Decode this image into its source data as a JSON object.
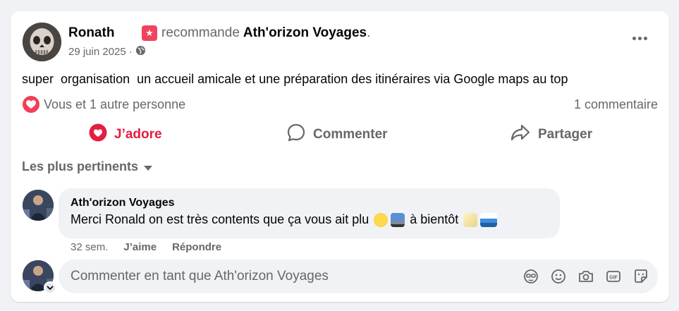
{
  "post": {
    "author": "Ronath",
    "badge_text": "recommande",
    "badge_page": "Ath'orizon Voyages",
    "badge_dot": ".",
    "date": "29 juin 2025",
    "date_separator": "·",
    "privacy_icon": "globe-icon",
    "text": "super  organisation  un accueil amicale et une préparation des itinéraires via Google maps au top",
    "reactions_text": "Vous et 1 autre personne",
    "comments_count": "1 commentaire"
  },
  "actions": {
    "love": "J’adore",
    "comment": "Commenter",
    "share": "Partager"
  },
  "sort_label": "Les plus pertinents",
  "comment": {
    "author": "Ath'orizon Voyages",
    "text_before": "Merci Ronald on est très contents que ça vous ait plu ",
    "text_middle": " à bientôt ",
    "time": "32 sem.",
    "like": "J’aime",
    "reply": "Répondre"
  },
  "composer": {
    "placeholder": "Commenter en tant que Ath'orizon Voyages",
    "tools": [
      "avatar-sticker-icon",
      "emoji-icon",
      "camera-icon",
      "gif-icon",
      "sticker-icon"
    ]
  },
  "colors": {
    "love_red": "#e41e3f",
    "heart_badge": "#f33e58",
    "secondary_text": "#65676b",
    "bubble_bg": "#f0f2f5"
  }
}
